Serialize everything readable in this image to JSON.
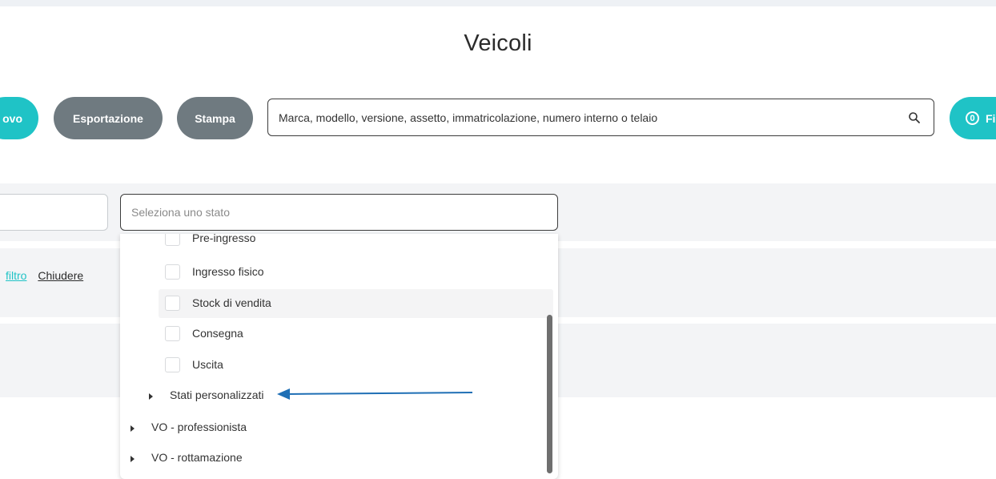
{
  "page": {
    "title": "Veicoli"
  },
  "toolbar": {
    "new_label": "ovo",
    "export_label": "Esportazione",
    "print_label": "Stampa",
    "search_placeholder": "Marca, modello, versione, assetto, immatricolazione, numero interno o telaio",
    "filter_count": "0",
    "filter_label": "Fi"
  },
  "filters": {
    "status_placeholder": "Seleziona uno stato",
    "filter_link": "filtro",
    "close_link": "Chiudere"
  },
  "dropdown": {
    "options": [
      {
        "label": "Pre-ingresso",
        "checked": false
      },
      {
        "label": "Ingresso fisico",
        "checked": false
      },
      {
        "label": "Stock di vendita",
        "checked": false,
        "highlighted": true
      },
      {
        "label": "Consegna",
        "checked": false
      },
      {
        "label": "Uscita",
        "checked": false
      }
    ],
    "groups": [
      {
        "label": "Stati personalizzati",
        "expanded": false
      },
      {
        "label": "VO - professionista",
        "expanded": false
      },
      {
        "label": "VO - rottamazione",
        "expanded": false
      }
    ]
  },
  "colors": {
    "accent_teal": "#1fc3c6",
    "button_grey": "#6f7a80",
    "annotation_arrow": "#1f6fb5"
  }
}
